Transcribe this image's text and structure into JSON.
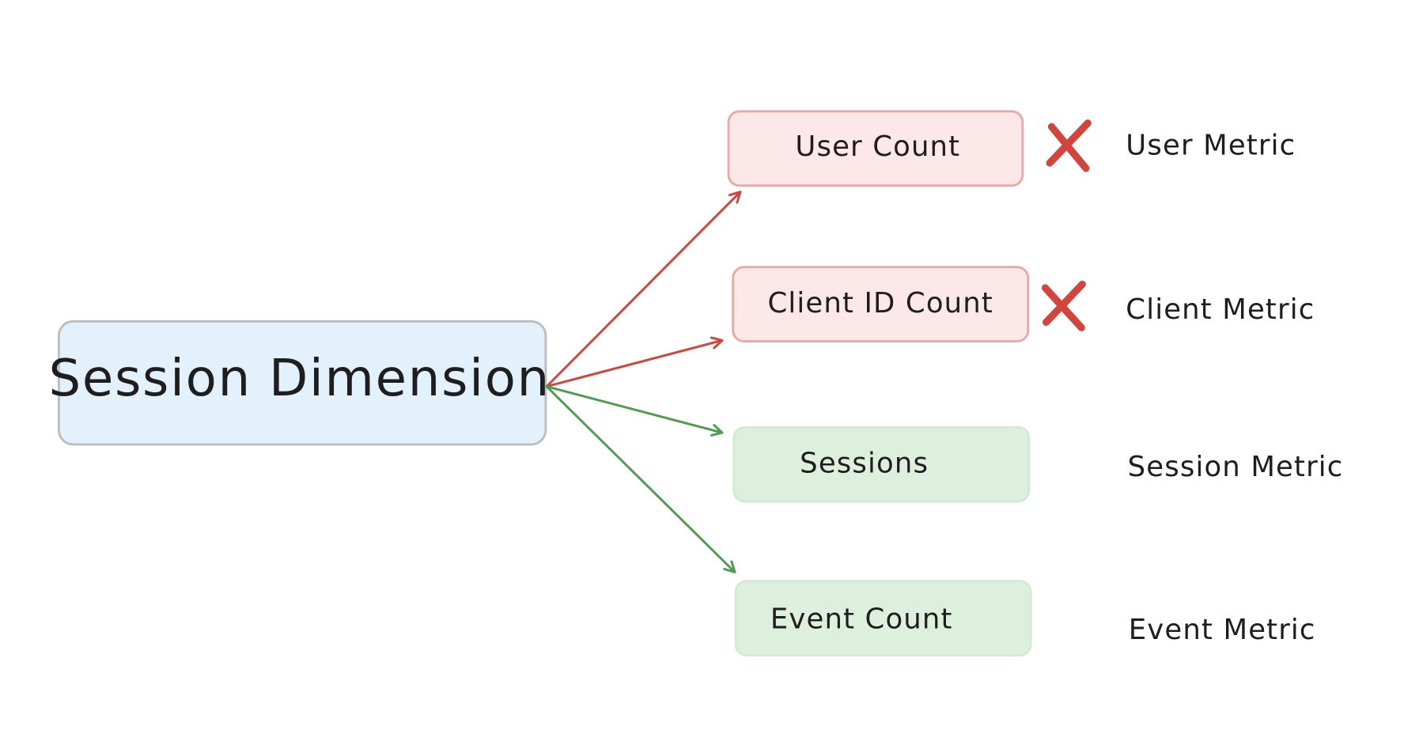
{
  "diagram": {
    "root": {
      "label": "Session Dimension",
      "fill": "#e3f1fd",
      "stroke": "#bdbdbd"
    },
    "colors": {
      "invalid_fill": "#fce8e8",
      "invalid_stroke": "#e8a8a8",
      "invalid_arrow": "#d2443c",
      "valid_fill": "#ddf0de",
      "valid_stroke": "#d2ead3",
      "valid_arrow": "#4f9d4e",
      "cross": "#d2443c",
      "text": "#1e1e1e"
    },
    "branches": [
      {
        "label": "User Count",
        "metric": "User Metric",
        "compatible": false,
        "marker": "cross-icon"
      },
      {
        "label": "Client ID Count",
        "metric": "Client Metric",
        "compatible": false,
        "marker": "cross-icon"
      },
      {
        "label": "Sessions",
        "metric": "Session Metric",
        "compatible": true,
        "marker": null
      },
      {
        "label": "Event Count",
        "metric": "Event Metric",
        "compatible": true,
        "marker": null
      }
    ]
  }
}
